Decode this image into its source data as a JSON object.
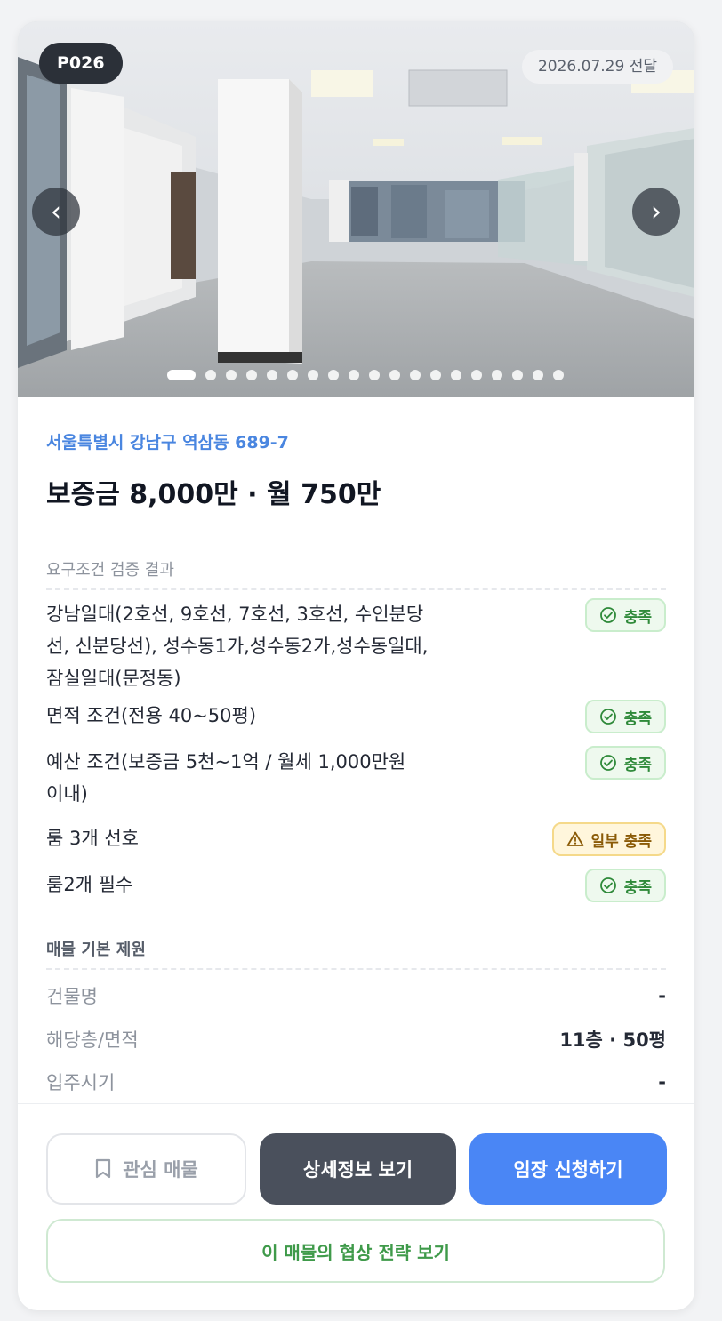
{
  "listing": {
    "code": "P026",
    "delivered_date": "2026.07.29 전달",
    "address": "서울특별시 강남구 역삼동 689-7",
    "price": "보증금 8,000만 · 월 750만"
  },
  "photo": {
    "prev_icon": "‹",
    "next_icon": "›",
    "slide_count": 19,
    "active_slide": 1
  },
  "requirements": {
    "section_title": "요구조건 검증 결과",
    "items": [
      {
        "text": "강남일대(2호선, 9호선, 7호선, 3호선, 수인분당선, 신분당선), 성수동1가,성수동2가,성수동일대, 잠실일대(문정동)",
        "status": "충족",
        "type": "ok"
      },
      {
        "text": "면적 조건(전용 40~50평)",
        "status": "충족",
        "type": "ok"
      },
      {
        "text": "예산 조건(보증금 5천~1억 / 월세 1,000만원 이내)",
        "status": "충족",
        "type": "ok"
      },
      {
        "text": "룸 3개 선호",
        "status": "일부 충족",
        "type": "partial"
      },
      {
        "text": "룸2개 필수",
        "status": "충족",
        "type": "ok"
      }
    ]
  },
  "specs": {
    "section_title": "매물 기본 제원",
    "rows": [
      {
        "label": "건물명",
        "value": "-"
      },
      {
        "label": "해당층/면적",
        "value": "11층 · 50평"
      },
      {
        "label": "입주시기",
        "value": "-"
      }
    ]
  },
  "actions": {
    "favorite_label": "관심 매물",
    "detail_label": "상세정보 보기",
    "apply_label": "임장 신청하기",
    "strategy_label": "이 매물의 협상 전략 보기"
  },
  "colors": {
    "accent_blue": "#4a86f5",
    "ok_green": "#2f8a3a",
    "partial_amber": "#8a5a06",
    "dark_button": "#4a505c"
  },
  "icons": {
    "ok": "check-circle-icon",
    "partial": "warning-triangle-icon",
    "favorite": "bookmark-icon"
  }
}
